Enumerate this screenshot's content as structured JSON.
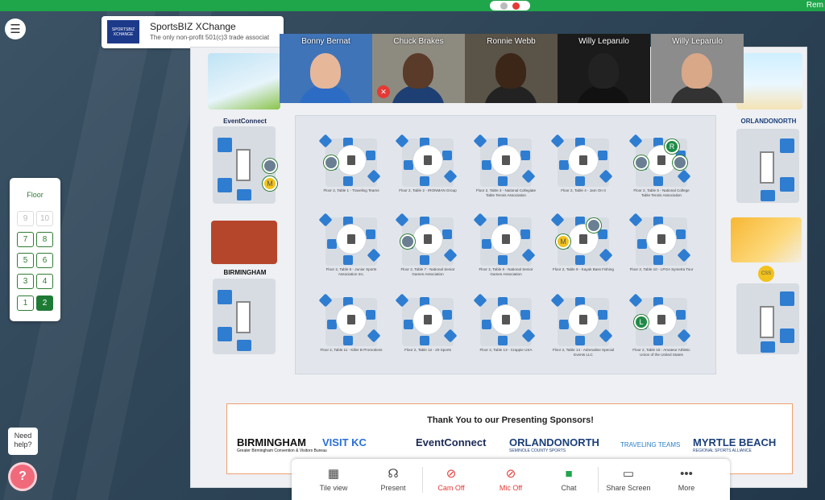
{
  "top": {
    "right_text": "Rem"
  },
  "event": {
    "logo_text": "SPORTSBIZ XCHANGE",
    "title": "SportsBIZ XChange",
    "subtitle": "The only non-profit 501(c)3 trade associat"
  },
  "floor": {
    "title": "Floor",
    "buttons": [
      {
        "label": "9",
        "state": "disabled"
      },
      {
        "label": "10",
        "state": "disabled"
      },
      {
        "label": "7",
        "state": "normal"
      },
      {
        "label": "8",
        "state": "normal"
      },
      {
        "label": "5",
        "state": "normal"
      },
      {
        "label": "6",
        "state": "normal"
      },
      {
        "label": "3",
        "state": "normal"
      },
      {
        "label": "4",
        "state": "normal"
      },
      {
        "label": "1",
        "state": "normal"
      },
      {
        "label": "2",
        "state": "active"
      }
    ]
  },
  "videos": [
    {
      "name": "Bonny Bernat",
      "bg": "#3f74b8",
      "skin": "#e7b79a",
      "shirt": "#2c6cc4",
      "muted": false
    },
    {
      "name": "Chuck Brakes",
      "bg": "#8d8a80",
      "skin": "#5a3a28",
      "shirt": "#1d3f73",
      "muted": true
    },
    {
      "name": "Ronnie Webb",
      "bg": "#5a5348",
      "skin": "#3b2618",
      "shirt": "#222",
      "muted": false
    },
    {
      "name": "Willy Leparulo",
      "bg": "#1b1b1b",
      "skin": "#222",
      "shirt": "#111",
      "muted": false
    },
    {
      "name": "Willy Leparulo",
      "bg": "#8c8c8c",
      "skin": "#d8a889",
      "shirt": "#333",
      "muted": false
    }
  ],
  "sponsors": {
    "event_connect": "EventConnect",
    "orlando_north": "ORLANDONORTH",
    "orlando_sub": "SEMINOLE COUNTY SPORTS",
    "birmingham": "BIRMINGHAM",
    "birmingham_sub": "Greater Birmingham Convention & Visitors Bureau",
    "css_badge": "CSS"
  },
  "tables": [
    {
      "label": "Floor 2, Table 1 - Traveling Teams",
      "avatars": [
        {
          "type": "photo",
          "text": ""
        }
      ]
    },
    {
      "label": "Floor 2, Table 2 - IRONMAN Group",
      "avatars": []
    },
    {
      "label": "Floor 2, Table 3 - National Collegiate Table Tennis Association",
      "avatars": []
    },
    {
      "label": "Floor 2, Table 4 - Jam On It",
      "avatars": []
    },
    {
      "label": "Floor 2, Table 5 - National College Table Tennis Association",
      "avatars": [
        {
          "type": "photo",
          "text": ""
        },
        {
          "type": "letter",
          "text": "R"
        },
        {
          "type": "photo",
          "text": ""
        }
      ]
    },
    {
      "label": "Floor 2, Table 6 - Junior Sports Association Inc.",
      "avatars": []
    },
    {
      "label": "Floor 2, Table 7 - National Senior Games Association",
      "avatars": [
        {
          "type": "photo",
          "text": ""
        }
      ]
    },
    {
      "label": "Floor 2, Table 8 - National Senior Games Association",
      "avatars": []
    },
    {
      "label": "Floor 2, Table 9 - Kayak Bass Fishing",
      "avatars": [
        {
          "type": "yellow",
          "text": "M"
        },
        {
          "type": "photo",
          "text": ""
        }
      ]
    },
    {
      "label": "Floor 2, Table 10 - LPGA Symetra Tour",
      "avatars": []
    },
    {
      "label": "Floor 2, Table 11 - Killer B Promotions",
      "avatars": []
    },
    {
      "label": "Floor 2, Table 12 - 20 Sports",
      "avatars": []
    },
    {
      "label": "Floor 2, Table 13 - Crappie USA",
      "avatars": []
    },
    {
      "label": "Floor 2, Table 14 - Adrenaline Special Events LLC",
      "avatars": []
    },
    {
      "label": "Floor 2, Table 15 - Amateur Athletic Union of the United States",
      "avatars": [
        {
          "type": "letter",
          "text": "L"
        }
      ]
    }
  ],
  "banner": {
    "title": "Thank You to our Presenting Sponsors!",
    "logos": [
      {
        "text": "BIRMINGHAM",
        "sub": "Greater Birmingham Convention & Visitors Bureau",
        "color": "#111"
      },
      {
        "text": "VISIT KC",
        "sub": "",
        "color": "#2a6fd6"
      },
      {
        "text": "EventConnect",
        "sub": "",
        "color": "#1b2a55"
      },
      {
        "text": "ORLANDONORTH",
        "sub": "SEMINOLE COUNTY SPORTS",
        "color": "#1b3f7a"
      },
      {
        "text": "TRAVELING TEAMS",
        "sub": "",
        "color": "#2a7fc8"
      },
      {
        "text": "MYRTLE BEACH",
        "sub": "REGIONAL SPORTS ALLIANCE",
        "color": "#1b3f7a"
      }
    ]
  },
  "help": {
    "bubble": "Need help?",
    "icon": "?"
  },
  "controls": [
    {
      "key": "tile",
      "label": "Tile view",
      "icon": "▦",
      "style": "normal"
    },
    {
      "key": "present",
      "label": "Present",
      "icon": "☊",
      "style": "normal"
    },
    {
      "key": "cam",
      "label": "Cam Off",
      "icon": "⊘",
      "style": "red"
    },
    {
      "key": "mic",
      "label": "Mic Off",
      "icon": "⊘",
      "style": "red"
    },
    {
      "key": "chat",
      "label": "Chat",
      "icon": "■",
      "style": "green"
    },
    {
      "key": "share",
      "label": "Share Screen",
      "icon": "▭",
      "style": "normal"
    },
    {
      "key": "more",
      "label": "More",
      "icon": "•••",
      "style": "normal"
    }
  ]
}
